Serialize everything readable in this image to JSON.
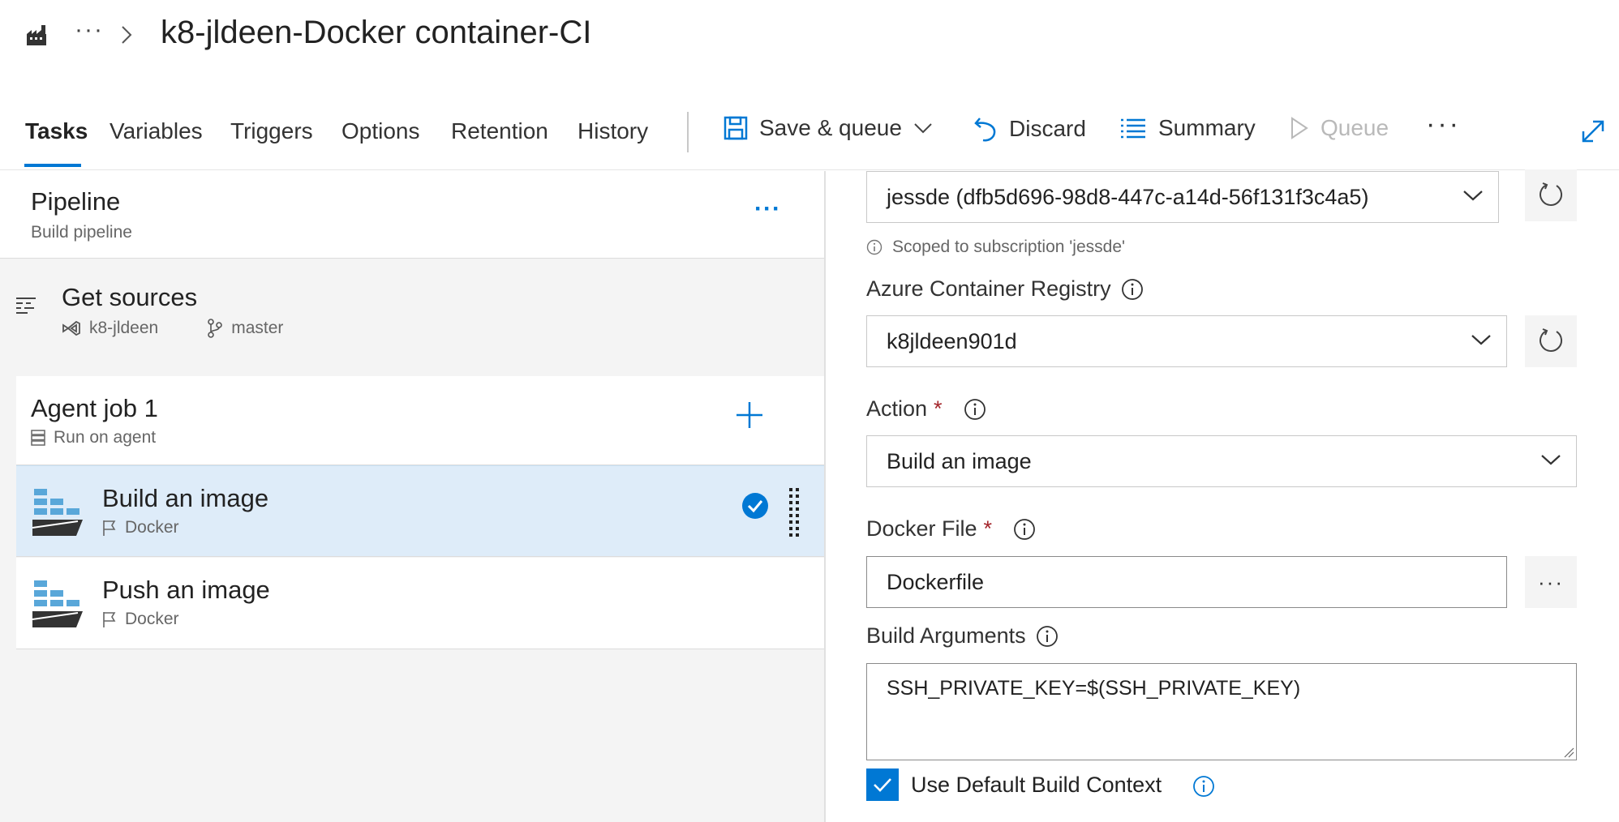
{
  "header": {
    "breadcrumb_more": "···",
    "title": "k8-jldeen-Docker container-CI"
  },
  "tabs": [
    {
      "label": "Tasks",
      "active": true
    },
    {
      "label": "Variables"
    },
    {
      "label": "Triggers"
    },
    {
      "label": "Options"
    },
    {
      "label": "Retention"
    },
    {
      "label": "History"
    }
  ],
  "toolbar": {
    "save_queue": "Save & queue",
    "discard": "Discard",
    "summary": "Summary",
    "queue": "Queue",
    "more": "···"
  },
  "pipeline": {
    "title": "Pipeline",
    "subtitle": "Build pipeline",
    "more": "···"
  },
  "sources": {
    "title": "Get sources",
    "repo": "k8-jldeen",
    "branch": "master"
  },
  "agent_job": {
    "title": "Agent job 1",
    "subtitle": "Run on agent"
  },
  "tasks": [
    {
      "title": "Build an image",
      "subtitle": "Docker",
      "selected": true
    },
    {
      "title": "Push an image",
      "subtitle": "Docker",
      "selected": false
    }
  ],
  "form": {
    "subscription_value": "jessde (dfb5d696-98d8-447c-a14d-56f131f3c4a5)",
    "scope_note": "Scoped to subscription 'jessde'",
    "registry_label": "Azure Container Registry",
    "registry_value": "k8jldeen901d",
    "action_label": "Action",
    "action_value": "Build an image",
    "dockerfile_label": "Docker File",
    "dockerfile_value": "Dockerfile",
    "browse": "···",
    "build_args_label": "Build Arguments",
    "build_args_value": "SSH_PRIVATE_KEY=$(SSH_PRIVATE_KEY)",
    "use_default_context_label": "Use Default Build Context",
    "use_default_context_checked": true,
    "required_mark": "*"
  },
  "colors": {
    "accent": "#0078d4",
    "selected_row": "#deecf9",
    "required": "#a4262c"
  }
}
